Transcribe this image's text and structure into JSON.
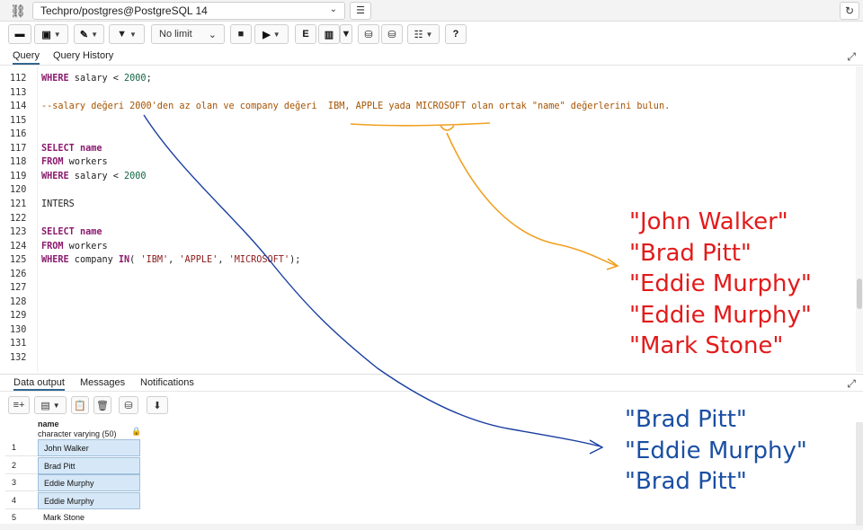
{
  "connection": {
    "label": "Techpro/postgres@PostgreSQL 14",
    "chevron": "⌄"
  },
  "toolbar": {
    "limit_label": "No limit",
    "chevron": "⌄"
  },
  "tabs": {
    "query": "Query",
    "history": "Query History"
  },
  "editor": {
    "lines": [
      {
        "n": "112",
        "parts": [
          [
            "kw",
            "WHERE"
          ],
          [
            "",
            " salary < "
          ],
          [
            "num",
            "2000"
          ],
          [
            "",
            ";"
          ]
        ]
      },
      {
        "n": "113",
        "parts": []
      },
      {
        "n": "114",
        "parts": [
          [
            "cm",
            "--salary değeri 2000'den az olan ve company değeri  IBM, APPLE yada MICROSOFT olan ortak \"name\" değerlerini bulun."
          ]
        ]
      },
      {
        "n": "115",
        "parts": []
      },
      {
        "n": "116",
        "parts": []
      },
      {
        "n": "117",
        "parts": [
          [
            "kw",
            "SELECT"
          ],
          [
            "kw",
            " name"
          ]
        ]
      },
      {
        "n": "118",
        "parts": [
          [
            "kw",
            "FROM"
          ],
          [
            "",
            " workers"
          ]
        ]
      },
      {
        "n": "119",
        "parts": [
          [
            "kw",
            "WHERE"
          ],
          [
            "",
            " salary < "
          ],
          [
            "num",
            "2000"
          ]
        ]
      },
      {
        "n": "120",
        "parts": []
      },
      {
        "n": "121",
        "parts": [
          [
            "",
            "INTERS"
          ]
        ]
      },
      {
        "n": "122",
        "parts": []
      },
      {
        "n": "123",
        "parts": [
          [
            "kw",
            "SELECT"
          ],
          [
            "kw",
            " name"
          ]
        ]
      },
      {
        "n": "124",
        "parts": [
          [
            "kw",
            "FROM"
          ],
          [
            "",
            " workers"
          ]
        ]
      },
      {
        "n": "125",
        "parts": [
          [
            "kw",
            "WHERE"
          ],
          [
            "",
            " company "
          ],
          [
            "kw",
            "IN"
          ],
          [
            "",
            "( "
          ],
          [
            "str",
            "'IBM'"
          ],
          [
            "",
            ", "
          ],
          [
            "str",
            "'APPLE'"
          ],
          [
            "",
            ", "
          ],
          [
            "str",
            "'MICROSOFT'"
          ],
          [
            "",
            ");"
          ]
        ]
      },
      {
        "n": "126",
        "parts": []
      },
      {
        "n": "127",
        "parts": []
      },
      {
        "n": "128",
        "parts": []
      },
      {
        "n": "129",
        "parts": []
      },
      {
        "n": "130",
        "parts": []
      },
      {
        "n": "131",
        "parts": []
      },
      {
        "n": "132",
        "parts": []
      }
    ]
  },
  "lower_tabs": {
    "data_output": "Data output",
    "messages": "Messages",
    "notifications": "Notifications"
  },
  "grid": {
    "column_name": "name",
    "column_type": "character varying (50)",
    "rows": [
      {
        "n": "1",
        "value": "John Walker"
      },
      {
        "n": "2",
        "value": "Brad Pitt"
      },
      {
        "n": "3",
        "value": "Eddie Murphy"
      },
      {
        "n": "4",
        "value": "Eddie Murphy"
      },
      {
        "n": "5",
        "value": "Mark Stone"
      }
    ]
  },
  "annotations": {
    "red": [
      "\"John Walker\"",
      "\"Brad Pitt\"",
      "\"Eddie Murphy\"",
      "\"Eddie Murphy\"",
      "\"Mark Stone\""
    ],
    "blue": [
      "\"Brad Pitt\"",
      "\"Eddie Murphy\"",
      "\"Brad Pitt\""
    ]
  },
  "colors": {
    "orange_arrow": "#f0a020",
    "blue_arrow": "#1a3fa0",
    "red_text": "#e21b1b",
    "blue_text": "#1a4fa3"
  }
}
